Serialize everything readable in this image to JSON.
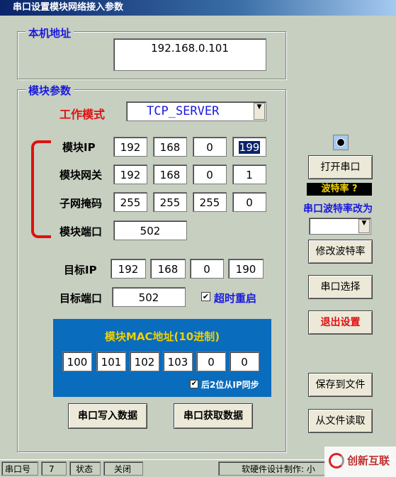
{
  "window": {
    "title": "串口设置模块网络接入参数"
  },
  "local_address": {
    "title": "本机地址",
    "value": "192.168.0.101"
  },
  "module_params": {
    "title": "模块参数",
    "work_mode_label": "工作模式",
    "work_mode_value": "TCP_SERVER",
    "module_ip_label": "模块IP",
    "module_ip": [
      "192",
      "168",
      "0",
      "199"
    ],
    "gateway_label": "模块网关",
    "gateway": [
      "192",
      "168",
      "0",
      "1"
    ],
    "mask_label": "子网掩码",
    "mask": [
      "255",
      "255",
      "255",
      "0"
    ],
    "module_port_label": "模块端口",
    "module_port": "502",
    "target_ip_label": "目标IP",
    "target_ip": [
      "192",
      "168",
      "0",
      "190"
    ],
    "target_port_label": "目标端口",
    "target_port": "502",
    "timeout_restart_label": "超时重启",
    "timeout_restart_checked": true
  },
  "mac": {
    "title": "模块MAC地址(10进制)",
    "values": [
      "100",
      "101",
      "102",
      "103",
      "0",
      "0"
    ],
    "sync_label": "后2位从IP同步",
    "sync_checked": true
  },
  "buttons": {
    "write": "串口写入数据",
    "read": "串口获取数据",
    "open_port": "打开串口",
    "change_baud": "修改波特率",
    "select_port": "串口选择",
    "exit": "退出设置",
    "save_file": "保存到文件",
    "load_file": "从文件读取"
  },
  "right_panel": {
    "baud_badge": "波特率 ?",
    "baud_change_label": "串口波特率改为",
    "baud_select_value": ""
  },
  "statusbar": {
    "port_label": "串口号",
    "port_value": "7",
    "state_label": "状态",
    "state_value": "关闭",
    "credit": "软硬件设计制作: 小"
  },
  "watermark": {
    "text": "创新互联"
  },
  "colors": {
    "background": "#c6cfc0",
    "group_title": "#1a1adc",
    "mac_panel": "#0a6cbc",
    "accent_red": "#e01010",
    "badge_text": "#f0d000"
  }
}
